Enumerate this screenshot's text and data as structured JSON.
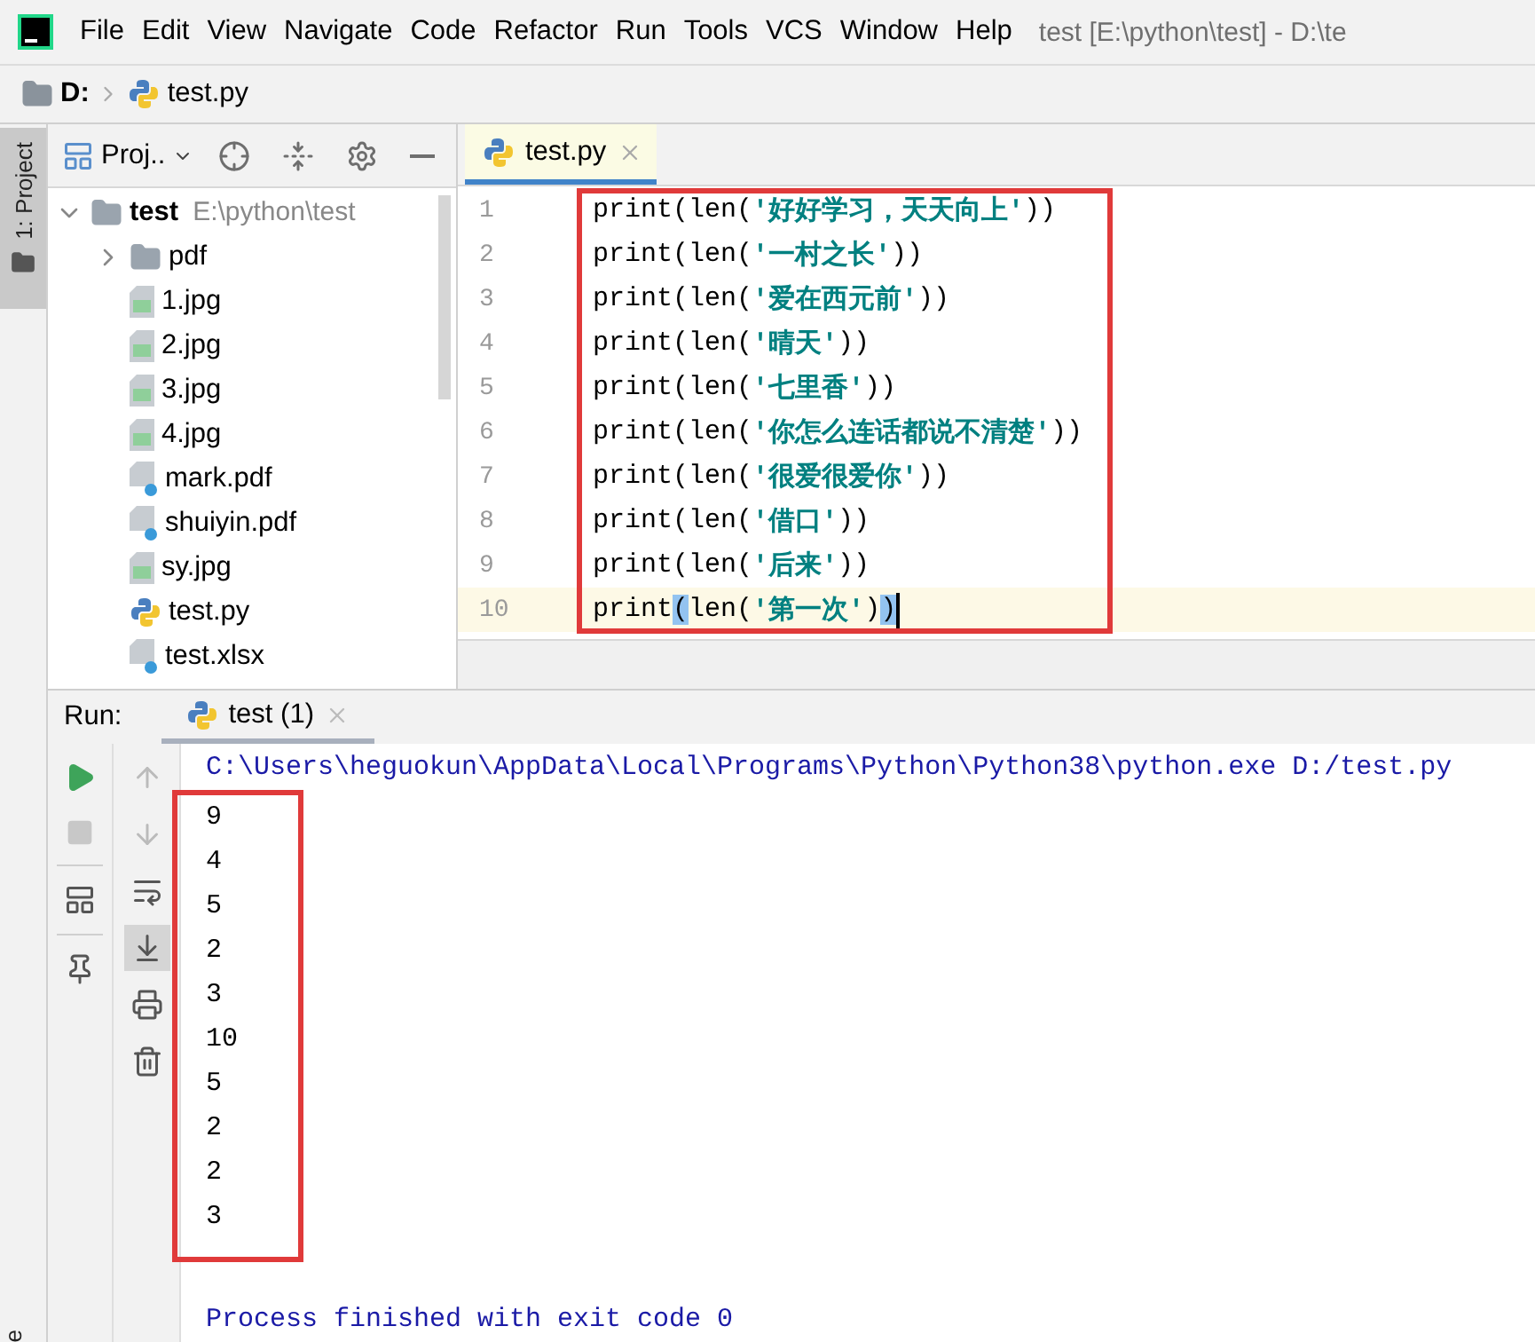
{
  "menu": {
    "items": [
      "File",
      "Edit",
      "View",
      "Navigate",
      "Code",
      "Refactor",
      "Run",
      "Tools",
      "VCS",
      "Window",
      "Help"
    ],
    "title": "test [E:\\python\\test] - D:\\te"
  },
  "breadcrumb": {
    "drive": "D:",
    "file": "test.py"
  },
  "side_strip": {
    "tab": "1: Project",
    "selected": true,
    "bottom_tab": "e"
  },
  "project": {
    "title": "Proj..",
    "tree": [
      {
        "label": "test",
        "path": "E:\\python\\test",
        "kind": "folder",
        "expanded": true,
        "children": [
          {
            "label": "pdf",
            "kind": "folder",
            "expanded": false
          },
          {
            "label": "1.jpg",
            "kind": "image"
          },
          {
            "label": "2.jpg",
            "kind": "image"
          },
          {
            "label": "3.jpg",
            "kind": "image"
          },
          {
            "label": "4.jpg",
            "kind": "image"
          },
          {
            "label": "mark.pdf",
            "kind": "unknown"
          },
          {
            "label": "shuiyin.pdf",
            "kind": "unknown"
          },
          {
            "label": "sy.jpg",
            "kind": "image"
          },
          {
            "label": "test.py",
            "kind": "python"
          },
          {
            "label": "test.xlsx",
            "kind": "unknown"
          }
        ]
      }
    ]
  },
  "editor": {
    "tabs": [
      {
        "label": "test.py",
        "selected": true
      }
    ],
    "lines": [
      {
        "number": "1",
        "current": false,
        "tokens": [
          {
            "text": "print(len(",
            "kind": "plain"
          },
          {
            "text": "'好好学习，天天向上'",
            "kind": "string"
          },
          {
            "text": "))",
            "kind": "plain"
          }
        ]
      },
      {
        "number": "2",
        "current": false,
        "tokens": [
          {
            "text": "print(len(",
            "kind": "plain"
          },
          {
            "text": "'一村之长'",
            "kind": "string"
          },
          {
            "text": "))",
            "kind": "plain"
          }
        ]
      },
      {
        "number": "3",
        "current": false,
        "tokens": [
          {
            "text": "print(len(",
            "kind": "plain"
          },
          {
            "text": "'爱在西元前'",
            "kind": "string"
          },
          {
            "text": "))",
            "kind": "plain"
          }
        ]
      },
      {
        "number": "4",
        "current": false,
        "tokens": [
          {
            "text": "print(len(",
            "kind": "plain"
          },
          {
            "text": "'晴天'",
            "kind": "string"
          },
          {
            "text": "))",
            "kind": "plain"
          }
        ]
      },
      {
        "number": "5",
        "current": false,
        "tokens": [
          {
            "text": "print(len(",
            "kind": "plain"
          },
          {
            "text": "'七里香'",
            "kind": "string"
          },
          {
            "text": "))",
            "kind": "plain"
          }
        ]
      },
      {
        "number": "6",
        "current": false,
        "tokens": [
          {
            "text": "print(len(",
            "kind": "plain"
          },
          {
            "text": "'你怎么连话都说不清楚'",
            "kind": "string"
          },
          {
            "text": "))",
            "kind": "plain"
          }
        ]
      },
      {
        "number": "7",
        "current": false,
        "tokens": [
          {
            "text": "print(len(",
            "kind": "plain"
          },
          {
            "text": "'很爱很爱你'",
            "kind": "string"
          },
          {
            "text": "))",
            "kind": "plain"
          }
        ]
      },
      {
        "number": "8",
        "current": false,
        "tokens": [
          {
            "text": "print(len(",
            "kind": "plain"
          },
          {
            "text": "'借口'",
            "kind": "string"
          },
          {
            "text": "))",
            "kind": "plain"
          }
        ]
      },
      {
        "number": "9",
        "current": false,
        "tokens": [
          {
            "text": "print(len(",
            "kind": "plain"
          },
          {
            "text": "'后来'",
            "kind": "string"
          },
          {
            "text": "))",
            "kind": "plain"
          }
        ]
      },
      {
        "number": "10",
        "current": true,
        "tokens": [
          {
            "text": "print",
            "kind": "plain"
          },
          {
            "text": "(",
            "kind": "brace"
          },
          {
            "text": "len(",
            "kind": "plain"
          },
          {
            "text": "'第一次'",
            "kind": "string"
          },
          {
            "text": ")",
            "kind": "plain"
          },
          {
            "text": ")",
            "kind": "brace"
          }
        ]
      }
    ]
  },
  "run": {
    "label": "Run:",
    "tabs": [
      {
        "label": "test (1)",
        "selected": true
      }
    ],
    "command": "C:\\Users\\heguokun\\AppData\\Local\\Programs\\Python\\Python38\\python.exe D:/test.py",
    "output": [
      "9",
      "4",
      "5",
      "2",
      "3",
      "10",
      "5",
      "2",
      "2",
      "3"
    ],
    "status": "Process finished with exit code 0"
  }
}
